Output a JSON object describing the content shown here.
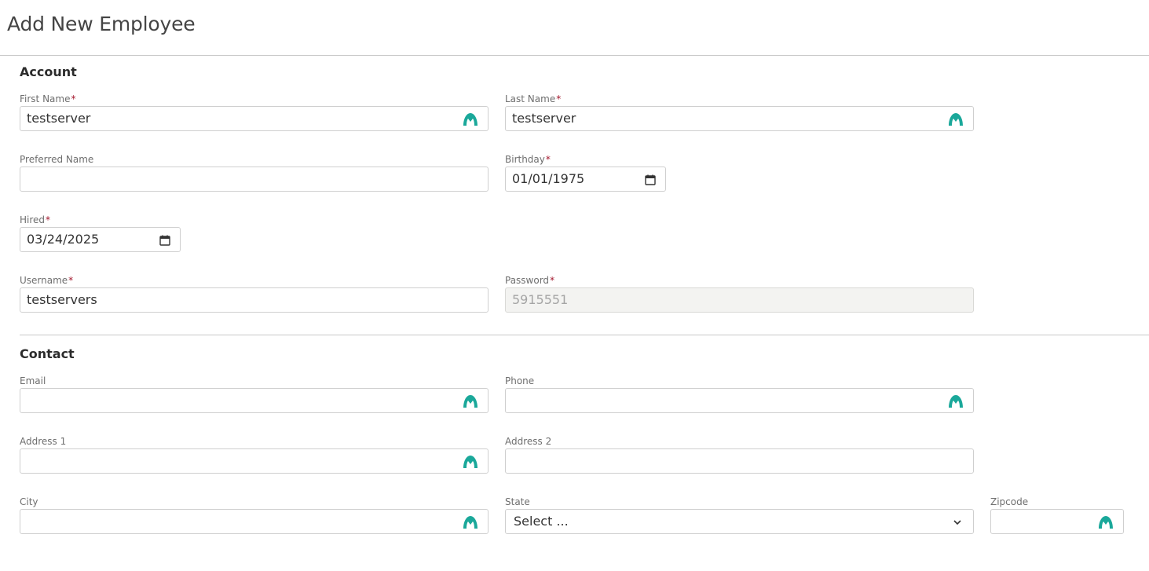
{
  "page": {
    "title": "Add New Employee"
  },
  "account": {
    "title": "Account",
    "first_name": {
      "label": "First Name",
      "required": "*",
      "value": "testserver"
    },
    "last_name": {
      "label": "Last Name",
      "required": "*",
      "value": "testserver"
    },
    "preferred_name": {
      "label": "Preferred Name",
      "value": ""
    },
    "birthday": {
      "label": "Birthday",
      "required": "*",
      "value": "01/01/1975"
    },
    "hired": {
      "label": "Hired",
      "required": "*",
      "value": "03/24/2025"
    },
    "username": {
      "label": "Username",
      "required": "*",
      "value": "testservers"
    },
    "password": {
      "label": "Password",
      "required": "*",
      "value": "5915551"
    }
  },
  "contact": {
    "title": "Contact",
    "email": {
      "label": "Email",
      "value": ""
    },
    "phone": {
      "label": "Phone",
      "value": ""
    },
    "address1": {
      "label": "Address 1",
      "value": ""
    },
    "address2": {
      "label": "Address 2",
      "value": ""
    },
    "city": {
      "label": "City",
      "value": ""
    },
    "state": {
      "label": "State",
      "selected": "Select ..."
    },
    "zipcode": {
      "label": "Zipcode",
      "value": ""
    }
  },
  "colors": {
    "required_asterisk": "#a3152b",
    "autofill_icon": "#1aa89a"
  },
  "icons": {
    "autofill": "autofill-icon",
    "calendar": "calendar-icon",
    "dropdown": "chevron-down-icon"
  }
}
